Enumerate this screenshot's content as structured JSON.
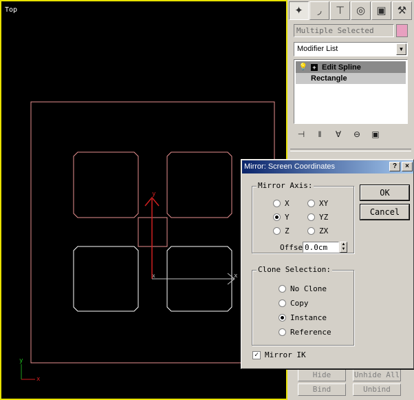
{
  "viewport": {
    "label": "Top",
    "border_color": "#e8e200",
    "axis_labels": {
      "gizmo_y": "y",
      "gizmo_x": "x",
      "world_y": "y",
      "world_x": "x"
    }
  },
  "command_panel": {
    "tabs": [
      {
        "name": "create",
        "icon": "✦"
      },
      {
        "name": "modify",
        "icon": "◞"
      },
      {
        "name": "hierarchy",
        "icon": "⊤"
      },
      {
        "name": "motion",
        "icon": "◎"
      },
      {
        "name": "display",
        "icon": "▣"
      },
      {
        "name": "utilities",
        "icon": "⚒"
      }
    ],
    "name_field": "Multiple Selected",
    "color_swatch": "#e8a0c0",
    "modifier_list": "Modifier List",
    "stack": [
      {
        "label": "Edit Spline"
      },
      {
        "label": "Rectangle"
      }
    ],
    "bottom_buttons": [
      "Hide",
      "Unhide All",
      "Bind",
      "Unbind"
    ]
  },
  "dialog": {
    "title": "Mirror: Screen Coordinates",
    "help_label": "?",
    "close_label": "×",
    "mirror_axis": {
      "label": "Mirror Axis:",
      "options": [
        "X",
        "Y",
        "Z",
        "XY",
        "YZ",
        "ZX"
      ],
      "selected": "Y",
      "offset_label": "Offset:",
      "offset_value": "0.0cm"
    },
    "clone_selection": {
      "label": "Clone Selection:",
      "options": [
        "No Clone",
        "Copy",
        "Instance",
        "Reference"
      ],
      "selected": "Instance"
    },
    "ok_label": "OK",
    "cancel_label": "Cancel",
    "mirror_ik_label": "Mirror IK",
    "mirror_ik_checked": true
  }
}
